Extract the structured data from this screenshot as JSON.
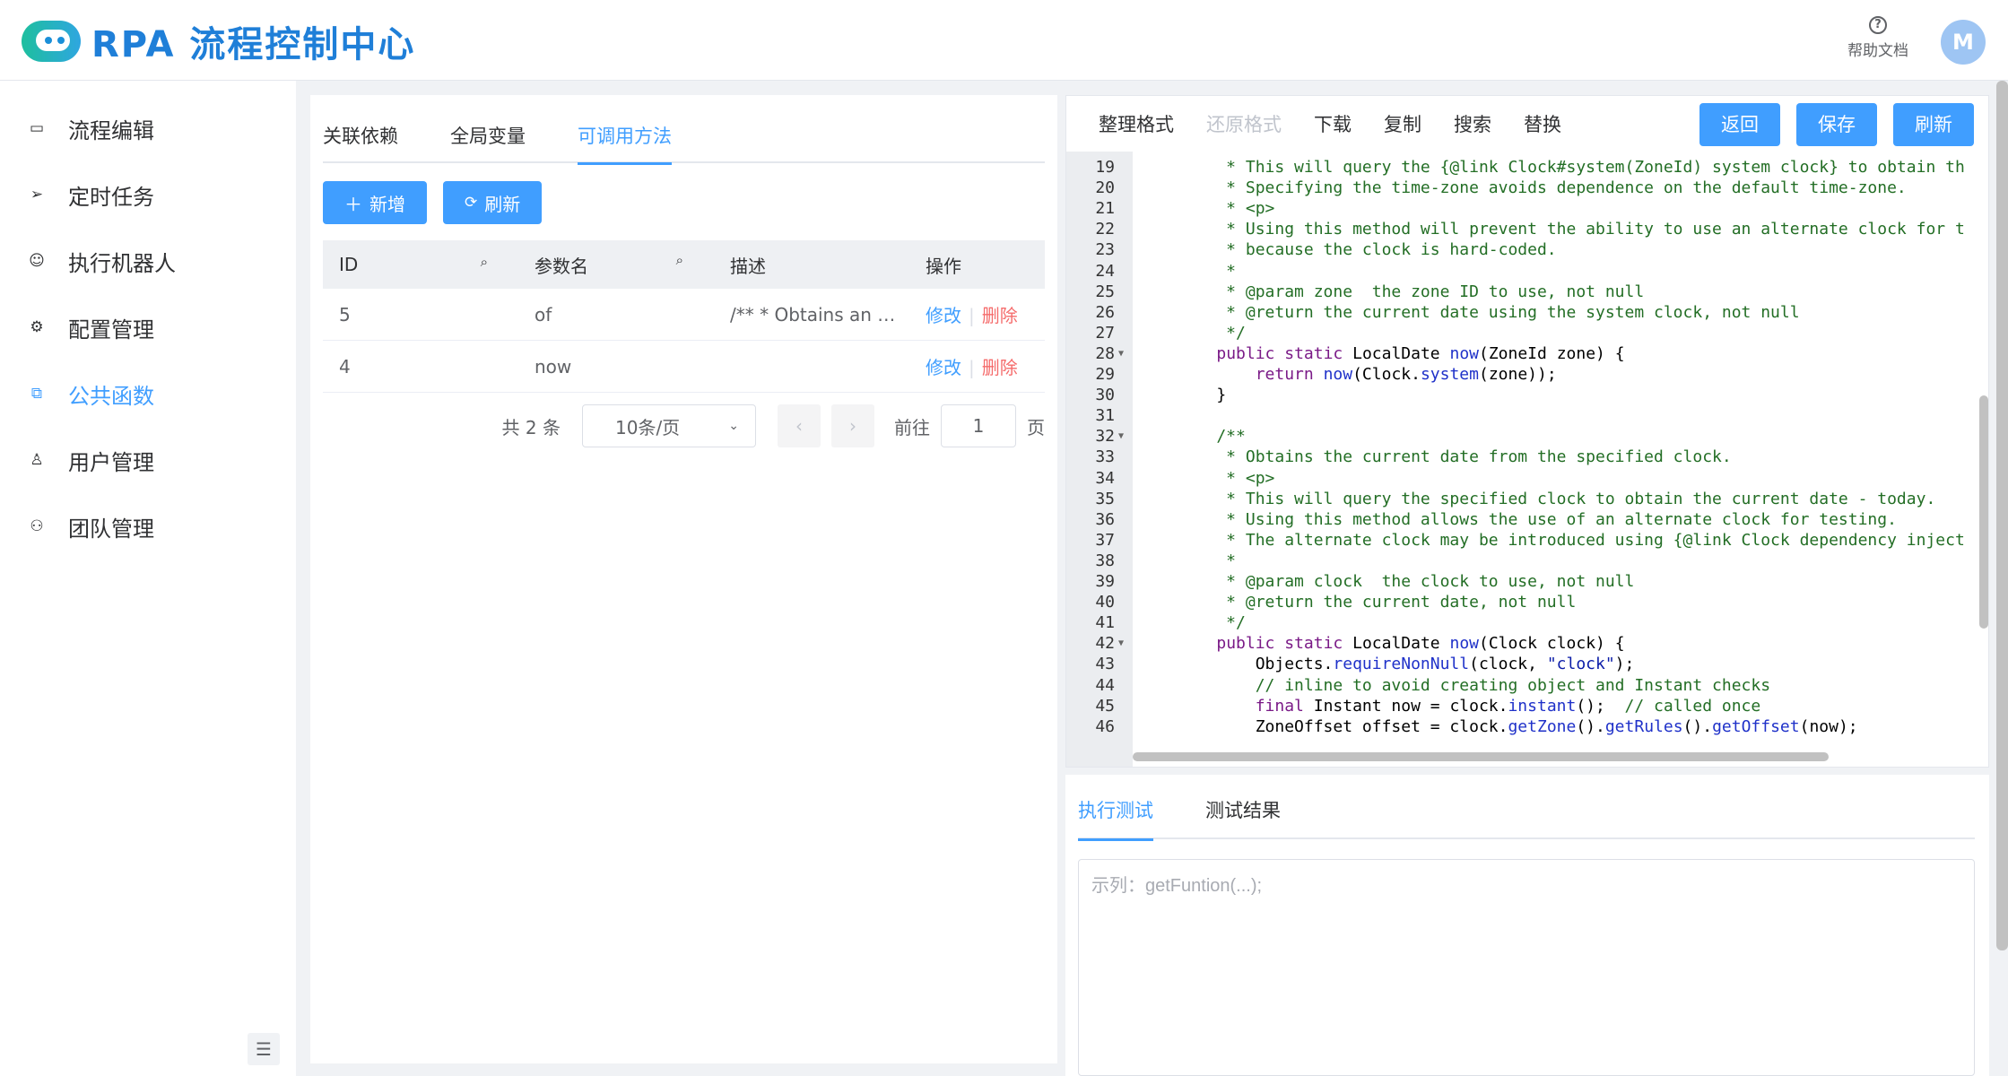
{
  "app": {
    "logo_text": "RPA 流程控制中心",
    "help_label": "帮助文档",
    "avatar_initial": "M"
  },
  "sidebar": {
    "items": [
      {
        "label": "流程编辑",
        "icon": "monitor-icon"
      },
      {
        "label": "定时任务",
        "icon": "send-icon"
      },
      {
        "label": "执行机器人",
        "icon": "robot-icon"
      },
      {
        "label": "配置管理",
        "icon": "gear-icon"
      },
      {
        "label": "公共函数",
        "icon": "function-icon",
        "active": true
      },
      {
        "label": "用户管理",
        "icon": "user-icon"
      },
      {
        "label": "团队管理",
        "icon": "team-icon"
      }
    ]
  },
  "left": {
    "tabs": [
      "关联依赖",
      "全局变量",
      "可调用方法"
    ],
    "active_tab": "可调用方法",
    "add_label": "新增",
    "refresh_label": "刷新",
    "columns": [
      "ID",
      "参数名",
      "描述",
      "操作"
    ],
    "rows": [
      {
        "id": "5",
        "name": "of",
        "desc": "/** * Obtains an i...",
        "edit": "修改",
        "del": "删除"
      },
      {
        "id": "4",
        "name": "now",
        "desc": "",
        "edit": "修改",
        "del": "删除"
      }
    ],
    "pager": {
      "total": "共 2 条",
      "page_size": "10条/页",
      "goto": "前往",
      "page": "1",
      "page_suffix": "页"
    }
  },
  "editor": {
    "tools": [
      "整理格式",
      "还原格式",
      "下载",
      "复制",
      "搜索",
      "替换"
    ],
    "disabled_tool": "还原格式",
    "back_label": "返回",
    "save_label": "保存",
    "refresh_label": "刷新",
    "lines": [
      {
        "n": "19",
        "t": "     * This will query the {@link Clock#system(ZoneId) system clock} to obtain th"
      },
      {
        "n": "20",
        "t": "     * Specifying the time-zone avoids dependence on the default time-zone."
      },
      {
        "n": "21",
        "t": "     * <p>"
      },
      {
        "n": "22",
        "t": "     * Using this method will prevent the ability to use an alternate clock for t"
      },
      {
        "n": "23",
        "t": "     * because the clock is hard-coded."
      },
      {
        "n": "24",
        "t": "     *"
      },
      {
        "n": "25",
        "t": "     * @param zone  the zone ID to use, not null"
      },
      {
        "n": "26",
        "t": "     * @return the current date using the system clock, not null"
      },
      {
        "n": "27",
        "t": "     */"
      },
      {
        "n": "28",
        "t": "    public static LocalDate now(ZoneId zone) {",
        "fold": true
      },
      {
        "n": "29",
        "t": "        return now(Clock.system(zone));"
      },
      {
        "n": "30",
        "t": "    }"
      },
      {
        "n": "31",
        "t": ""
      },
      {
        "n": "32",
        "t": "    /**",
        "fold": true
      },
      {
        "n": "33",
        "t": "     * Obtains the current date from the specified clock."
      },
      {
        "n": "34",
        "t": "     * <p>"
      },
      {
        "n": "35",
        "t": "     * This will query the specified clock to obtain the current date - today."
      },
      {
        "n": "36",
        "t": "     * Using this method allows the use of an alternate clock for testing."
      },
      {
        "n": "37",
        "t": "     * The alternate clock may be introduced using {@link Clock dependency inject"
      },
      {
        "n": "38",
        "t": "     *"
      },
      {
        "n": "39",
        "t": "     * @param clock  the clock to use, not null"
      },
      {
        "n": "40",
        "t": "     * @return the current date, not null"
      },
      {
        "n": "41",
        "t": "     */"
      },
      {
        "n": "42",
        "t": "    public static LocalDate now(Clock clock) {",
        "fold": true
      },
      {
        "n": "43",
        "t": "        Objects.requireNonNull(clock, \"clock\");"
      },
      {
        "n": "44",
        "t": "        // inline to avoid creating object and Instant checks"
      },
      {
        "n": "45",
        "t": "        final Instant now = clock.instant();  // called once"
      },
      {
        "n": "46",
        "t": "        ZoneOffset offset = clock.getZone().getRules().getOffset(now);"
      }
    ]
  },
  "test": {
    "tabs": [
      "执行测试",
      "测试结果"
    ],
    "active_tab": "执行测试",
    "placeholder": "示列：getFuntion(...);"
  }
}
